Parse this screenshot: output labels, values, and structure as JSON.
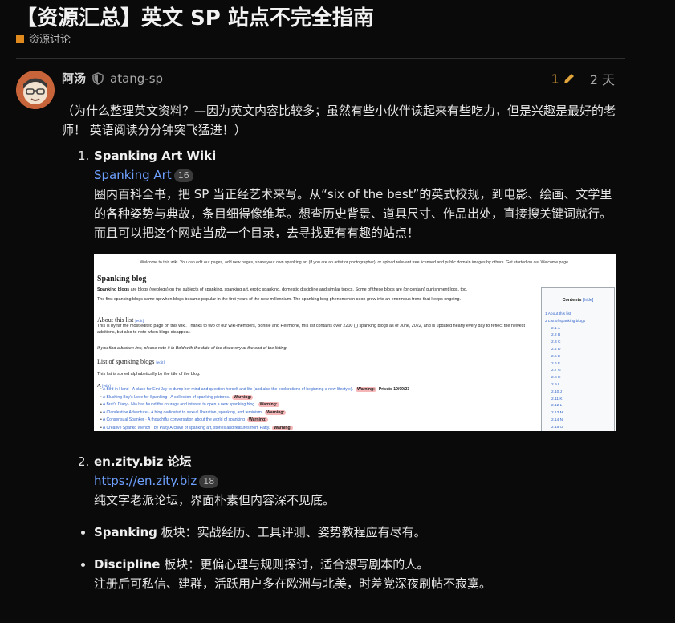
{
  "topic": {
    "title": "【资源汇总】英文 SP 站点不完全指南",
    "category": "资源讨论",
    "category_color": "#e08a1e"
  },
  "post": {
    "author_name": "阿汤",
    "author_handle": "atang-sp",
    "edit_count": "1",
    "time": "2 天",
    "intro": "（为什么整理英文资料？—因为英文内容比较多；虽然有些小伙伴读起来有些吃力，但是兴趣是最好的老师！ 英语阅读分分钟突飞猛进！）",
    "items": [
      {
        "num": "1.",
        "title": "Spanking Art Wiki",
        "link": "Spanking Art",
        "link_count": "16",
        "desc": "圈内百科全书，把 SP 当正经艺术来写。从“six of the best”的英式校规，到电影、绘画、文学里的各种姿势与典故，条目细得像维基。想查历史背景、道具尺寸、作品出处，直接搜关键词就行。",
        "desc2": "而且可以把这个网站当成一个目录，去寻找更有有趣的站点！"
      },
      {
        "num": "2.",
        "title": "en.zity.biz 论坛",
        "link": "https://en.zity.biz",
        "link_count": "18",
        "desc": "纯文字老派论坛，界面朴素但内容深不见底。"
      }
    ],
    "bullets": [
      {
        "bold": "Spanking",
        "text": " 板块：实战经历、工具评测、姿势教程应有尽有。"
      },
      {
        "bold": "Discipline",
        "text": " 板块：更偏心理与规则探讨，适合想写剧本的人。",
        "text2": "注册后可私信、建群，活跃用户多在欧洲与北美，时差党深夜刷帖不寂寞。"
      }
    ]
  },
  "screenshot": {
    "welcome": "Welcome to this wiki. You can edit our pages, add new pages, share your own spanking art (if you are an artist or photographer), or upload relevant free licensed and public domain images by others. Get started on our Welcome page.",
    "heading": "Spanking blog",
    "lead_bold": "Spanking blogs",
    "lead": " are blogs (weblogs) on the subjects of spanking, spanking art, erotic spanking, domestic discipline and similar topics. Some of these blogs are (or contain) punishment logs, too.",
    "lead2": "The first spanking blogs came up when blogs became popular in the first years of the new millennium. The spanking blog phenomenon soon grew into an enormous trend that keeps ongoing.",
    "about_heading": "About this list",
    "edit": "[edit]",
    "about1": "This is by far the most edited page on this wiki. Thanks to two of our wiki-members, Bonnie and Hermione, this list contains over 2200 (!) spanking blogs as of June, 2022, and is updated nearly every day to reflect the newest additions, but also to note when blogs disappear.",
    "about2": "If you find a broken link, please note it in Bold with the date of the discovery at the end of the listing.",
    "list_heading": "List of spanking blogs",
    "list_note": "This list is sorted alphabetically by the title of the blog.",
    "letter": "A",
    "entries": [
      "A Bird in Hand · A place for Emi Jay to dump her mind and question herself and life (and also the explorations of beginning a new lifestyle).",
      "A Blushing Boy's Love for Spanking · A collection of spanking pictures.",
      "A Brat's Diary · Nia has found the courage and interest to open a new spanking blog.",
      "A Clandestine Adventure · A blog dedicated to sexual liberation, spanking, and feminism.",
      "A Consensual Spanker · A thoughtful conversation about the world of spanking",
      "A Creative Spanko Wench · by Patty Archive of spanking art, stories and features from Patty."
    ],
    "warning": "Warning:",
    "private": "Private 10/09/23",
    "toc_title": "Contents",
    "toc_hide": "[hide]",
    "toc": [
      "1 About this list",
      "2 List of spanking blogs",
      "2.1 A",
      "2.2 B",
      "2.3 C",
      "2.4 D",
      "2.5 E",
      "2.6 F",
      "2.7 G",
      "2.8 H",
      "2.9 I",
      "2.10 J",
      "2.11 K",
      "2.12 L",
      "2.13 M",
      "2.14 N",
      "2.15 O",
      "2.16 P",
      "2.17 Q"
    ]
  }
}
